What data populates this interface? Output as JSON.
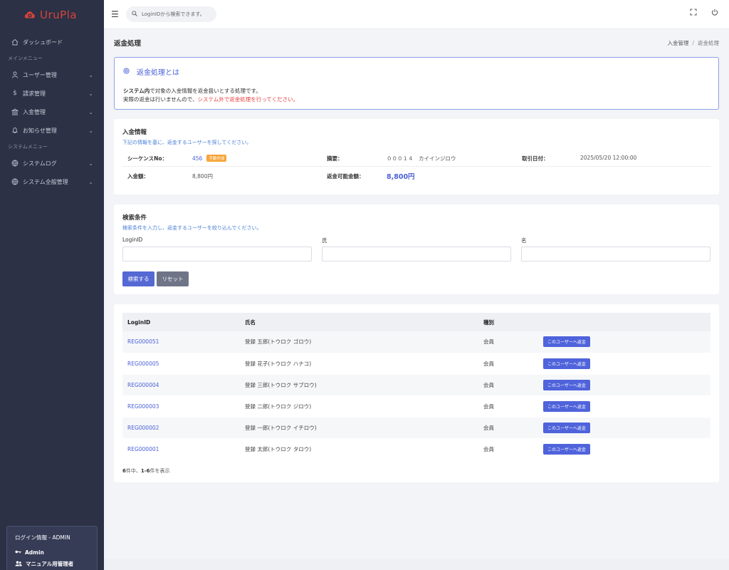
{
  "app": {
    "brand": "UruPla"
  },
  "sidebar": {
    "dashboard": "ダッシュボード",
    "section_main": "メインメニュー",
    "items_main": [
      {
        "label": "ユーザー管理",
        "icon": "user-icon"
      },
      {
        "label": "請求管理",
        "icon": "dollar-icon"
      },
      {
        "label": "入金管理",
        "icon": "bank-icon"
      },
      {
        "label": "お知らせ管理",
        "icon": "bell-icon"
      }
    ],
    "section_system": "システムメニュー",
    "items_system": [
      {
        "label": "システムログ",
        "icon": "globe-icon"
      },
      {
        "label": "システム全般管理",
        "icon": "globe-icon"
      }
    ],
    "login_info": {
      "title": "ログイン情報 - ADMIN",
      "user": "Admin",
      "role": "マニュアル用管理者"
    }
  },
  "header": {
    "search_placeholder": "LoginIDから検索できます。"
  },
  "page": {
    "title": "返金処理",
    "breadcrumb": [
      "入金管理",
      "返金処理"
    ]
  },
  "info": {
    "title": "返金処理とは",
    "line1_bold": "システム内",
    "line1_rest": "で対象の入金情報を返金扱いとする処理です。",
    "line2_plain": "実際の返金は行いませんので、",
    "line2_red": "システム外で返金処理を行ってください。"
  },
  "payment": {
    "title": "入金情報",
    "subtitle": "下記の情報を基に、返金するユーザーを探してください。",
    "sequence_label": "シーケンスNo：",
    "sequence_value": "456",
    "sequence_badge": "手動作成",
    "summary_label": "摘要：",
    "summary_value": "０００１４　カイインジロウ",
    "date_label": "取引日付：",
    "date_value": "2025/05/20 12:00:00",
    "amount_label": "入金額：",
    "amount_value": "8,800円",
    "refundable_label": "返金可能金額：",
    "refundable_value": "8,800円"
  },
  "search_form": {
    "title": "検索条件",
    "subtitle": "検索条件を入力し、返金するユーザーを絞り込んでください。",
    "loginid_label": "LoginID",
    "last_label": "氏",
    "first_label": "名",
    "loginid_value": "",
    "last_value": "",
    "first_value": "",
    "search_button": "検索する",
    "reset_button": "リセット"
  },
  "table": {
    "headers": [
      "LoginID",
      "氏名",
      "種別",
      ""
    ],
    "rows": [
      {
        "id": "REG000051",
        "name": "登録 五郎(トウロク ゴロウ)",
        "type": "会員",
        "action": "このユーザーへ返金"
      },
      {
        "id": "REG000005",
        "name": "登録 花子(トウロク ハナコ)",
        "type": "会員",
        "action": "このユーザーへ返金"
      },
      {
        "id": "REG000004",
        "name": "登録 三郎(トウロク サブロウ)",
        "type": "会員",
        "action": "このユーザーへ返金"
      },
      {
        "id": "REG000003",
        "name": "登録 二郎(トウロク ジロウ)",
        "type": "会員",
        "action": "このユーザーへ返金"
      },
      {
        "id": "REG000002",
        "name": "登録 一郎(トウロク イチロウ)",
        "type": "会員",
        "action": "このユーザーへ返金"
      },
      {
        "id": "REG000001",
        "name": "登録 太郎(トウロク タロウ)",
        "type": "会員",
        "action": "このユーザーへ返金"
      }
    ],
    "footer_total": "6",
    "footer_mid": "件中、",
    "footer_range": "1-6",
    "footer_end": "件を表示"
  },
  "colors": {
    "sidebar_bg": "#2c3145",
    "accent": "#5469d4",
    "brand_red": "#d7433e",
    "warning": "#f6a53a",
    "alert_text": "#e83d3d"
  }
}
